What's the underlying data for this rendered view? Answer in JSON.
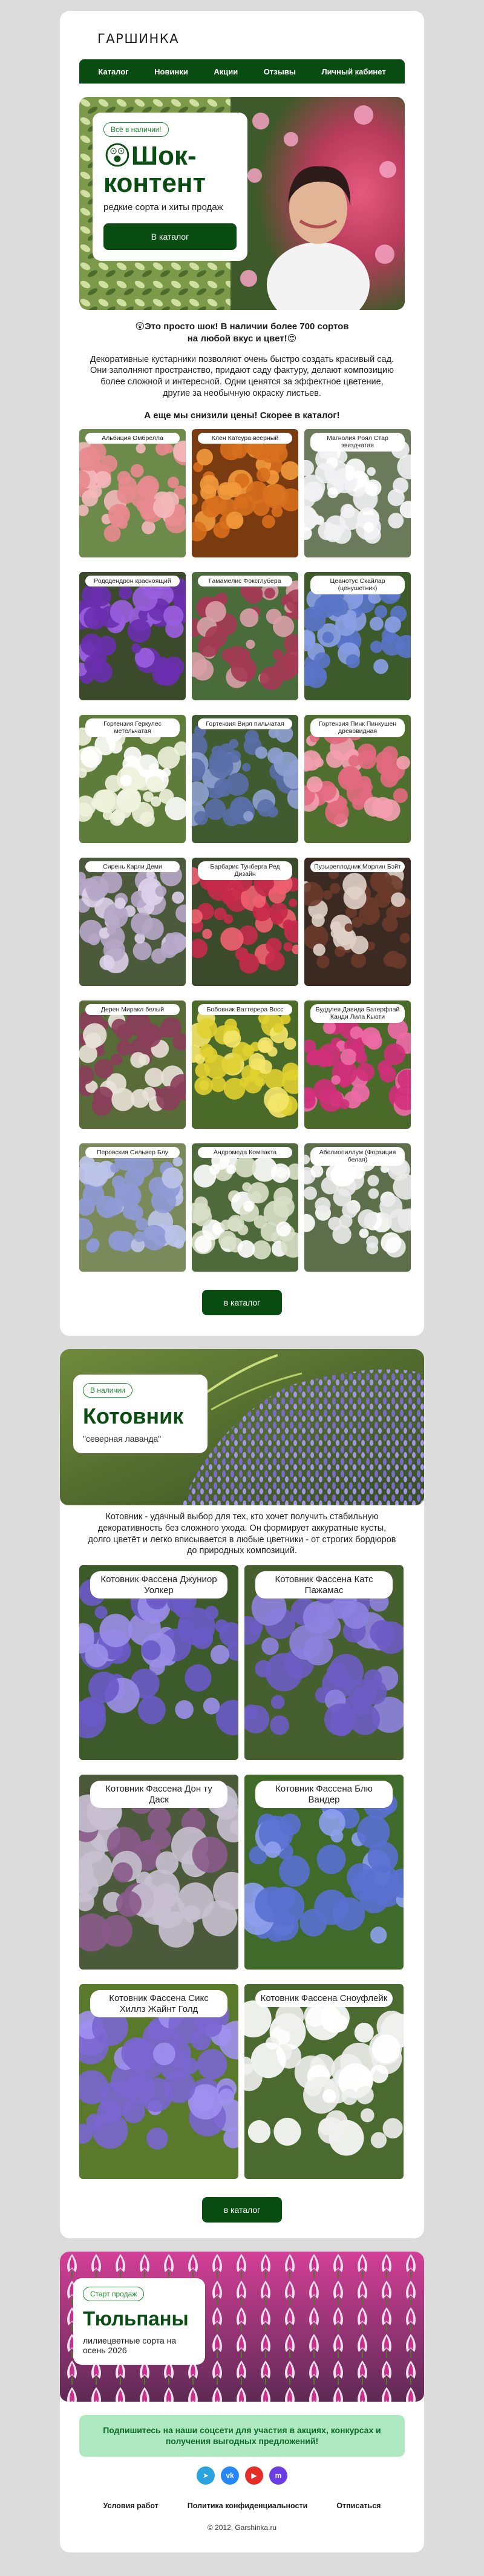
{
  "header": {
    "logo_text": "ГАРШИНКА",
    "nav": [
      "Каталог",
      "Новинки",
      "Акции",
      "Отзывы",
      "Личный кабинет"
    ]
  },
  "hero": {
    "badge": "Всё в наличии!",
    "emoji": "😲",
    "title_line1": "Шок-",
    "title_line2": "контент",
    "subtitle": "редкие сорта и хиты продаж",
    "button": "В каталог"
  },
  "intro": {
    "head_line1": "😲Это просто шок! В наличии более 700 сортов",
    "head_line2": "на любой вкус и цвет!😍",
    "text": "Декоративные кустарники позволяют очень быстро создать красивый сад. Они заполняют пространство, придают саду фактуру, делают композицию более сложной и интересной. Одни ценятся за эффектное цветение, другие за необычную окраску листьев.",
    "grid_head": "А еще мы снизили цены! Скорее в каталог!"
  },
  "shrubs": [
    {
      "label": "Альбиция Омбрелла"
    },
    {
      "label": "Клен Катсура веерный"
    },
    {
      "label": "Магнолия Роял Стар звездчатая"
    },
    {
      "label": "Рододендрон красноящий"
    },
    {
      "label": "Гамамелис Фоксглубера"
    },
    {
      "label": "Цеанотус Скайлар (ценушетник)"
    },
    {
      "label": "Гортензия Геркулес метельчатая"
    },
    {
      "label": "Гортензия Вирл пильчатая"
    },
    {
      "label": "Гортензия Пинк Пинкушен древовидная"
    },
    {
      "label": "Сирень Карли Деми"
    },
    {
      "label": "Барбарис Тунберга Ред Дизайн"
    },
    {
      "label": "Пузыреплодник Морлин Бэйт"
    },
    {
      "label": "Дерен Миракл белый"
    },
    {
      "label": "Бобовник Ваттерера Восс"
    },
    {
      "label": "Буддлея Давида Батерфлай Канди Лила Кьюти"
    },
    {
      "label": "Перовския Сильвер Блу"
    },
    {
      "label": "Андромеда Компакта"
    },
    {
      "label": "Абелиопиллум (Форзиция белая)"
    }
  ],
  "catalog_button": "в каталог",
  "kotovnik": {
    "badge": "В наличии",
    "title": "Котовник",
    "subtitle": "\"северная лаванда\"",
    "text": "Котовник - удачный выбор для тех, кто хочет получить стабильную декоративность без сложного ухода. Он формирует аккуратные кусты, долго цветёт и легко вписывается в любые цветники - от строгих бордюров до природных композиций.",
    "items": [
      {
        "label": "Котовник Фассена Джуниор Уолкер"
      },
      {
        "label": "Котовник Фассена Катс Пажамас"
      },
      {
        "label": "Котовник Фассена Дон ту Даск"
      },
      {
        "label": "Котовник Фассена Блю Вандер"
      },
      {
        "label": "Котовник Фассена Сикс Хиллз Жайнт Голд"
      },
      {
        "label": "Котовник Фассена Сноуфлейк"
      }
    ],
    "button": "в каталог"
  },
  "tulips": {
    "badge": "Старт продаж",
    "title": "Тюльпаны",
    "subtitle": "лилиецветные сорта на осень 2026"
  },
  "footer": {
    "banner": "Подпишитесь на наши соцсети для участия в акциях, конкурсах и получения выгодных предложений!",
    "socials": [
      {
        "name": "telegram-icon",
        "color": "#2aa3df",
        "glyph": "➤"
      },
      {
        "name": "vk-icon",
        "color": "#2787f5",
        "glyph": "vk"
      },
      {
        "name": "youtube-icon",
        "color": "#e52d27",
        "glyph": "▶"
      },
      {
        "name": "max-icon",
        "color": "#6a3ee0",
        "glyph": "m"
      }
    ],
    "links": [
      "Условия работ",
      "Политика конфиденциальности",
      "Отписаться"
    ],
    "copyright": "© 2012, Garshinka.ru"
  },
  "colors": {
    "brand_green": "#0a4d12",
    "accent_green": "#1a8a2e",
    "banner_bg": "#aee8c0"
  }
}
